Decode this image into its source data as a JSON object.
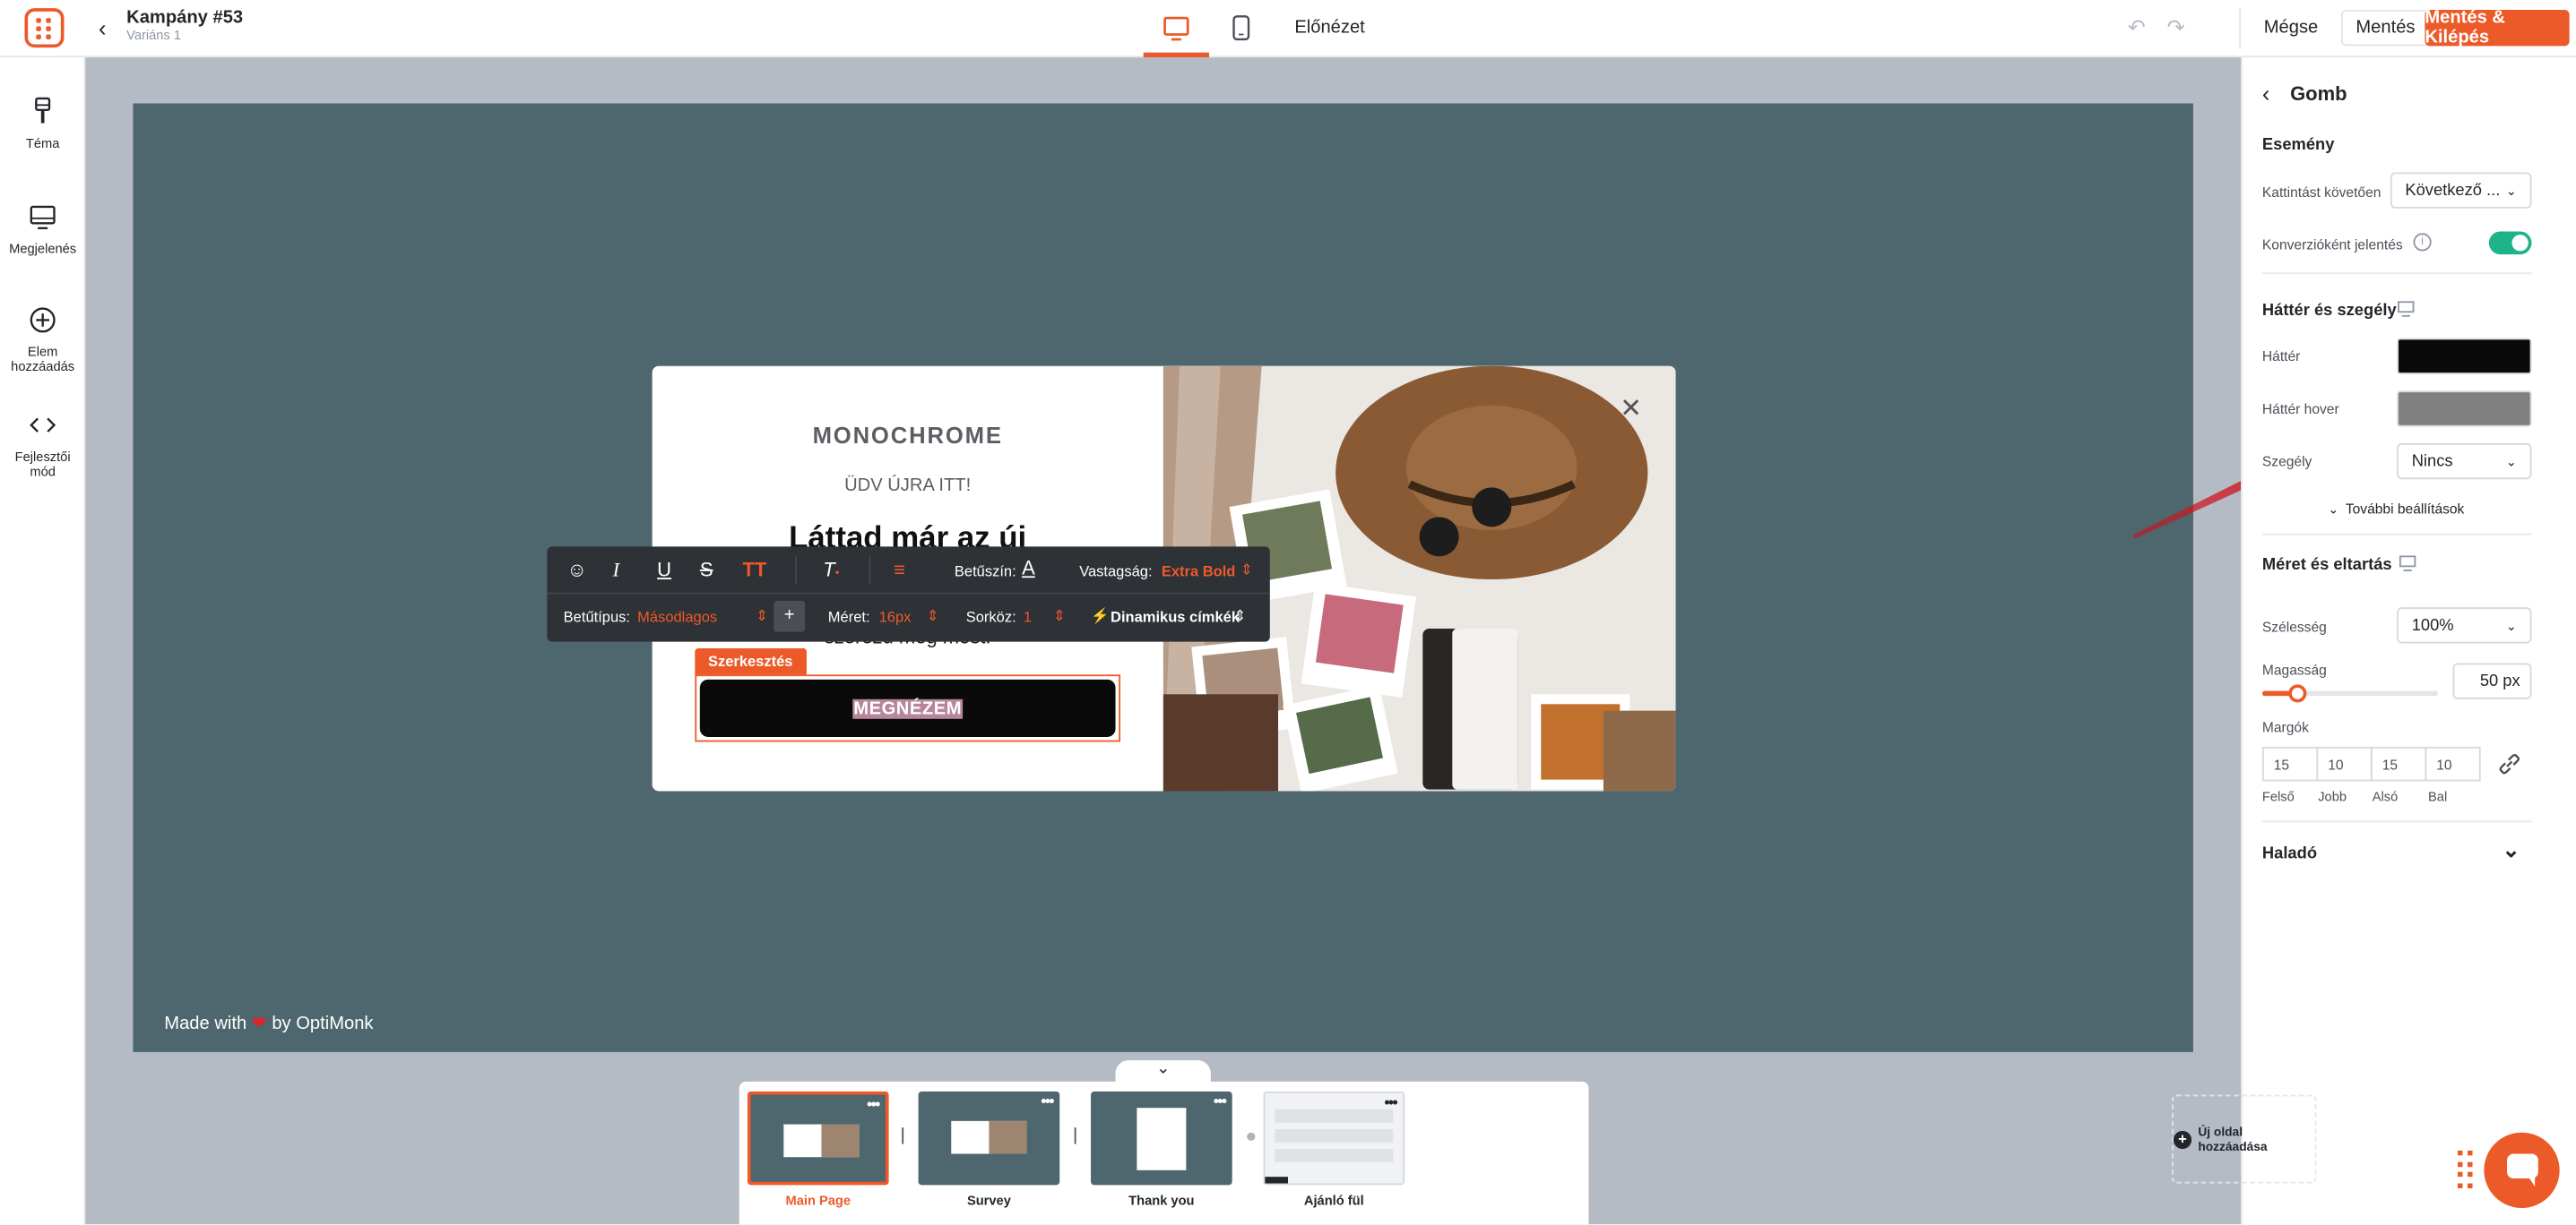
{
  "header": {
    "campaign_title": "Kampány #53",
    "variant": "Variáns 1",
    "preview": "Előnézet",
    "cancel": "Mégse",
    "save": "Mentés",
    "save_exit": "Mentés & Kilépés"
  },
  "sidebar": {
    "items": [
      {
        "label": "Téma",
        "icon": "brush-icon"
      },
      {
        "label": "Megjelenés",
        "icon": "monitor-icon"
      },
      {
        "label": "Elem hozzáadás",
        "icon": "plus-circle-icon"
      },
      {
        "label": "Fejlesztői mód",
        "icon": "code-icon"
      }
    ]
  },
  "canvas": {
    "made_with_prefix": "Made with",
    "made_with_suffix": "by OptiMonk",
    "popup": {
      "brand": "MONOCHROME",
      "welcome": "ÜDV ÚJRA ITT!",
      "headline": "Láttad már az új",
      "subline": "szerezd meg most!",
      "edit_tag": "Szerkesztés",
      "cta": "MEGNÉZEM"
    }
  },
  "toolbar": {
    "font_color_label": "Betűszín:",
    "weight_label": "Vastagság:",
    "weight_value": "Extra Bold",
    "font_label": "Betűtípus:",
    "font_value": "Másodlagos",
    "size_label": "Méret:",
    "size_value": "16px",
    "line_label": "Sorköz:",
    "line_value": "1",
    "dynamic_tags": "Dinamikus címkék"
  },
  "panel": {
    "title": "Gomb",
    "event_heading": "Esemény",
    "after_click_label": "Kattintást követően",
    "after_click_value": "Következő ...",
    "conversion_label": "Konverzióként jelentés",
    "conversion_on": true,
    "bg_heading": "Háttér és szegély",
    "bg_label": "Háttér",
    "bg_color": "#0a0a0a",
    "bg_hover_label": "Háttér hover",
    "bg_hover_color": "#808080",
    "border_label": "Szegély",
    "border_value": "Nincs",
    "more_settings": "További beállítások",
    "size_heading": "Méret és eltartás",
    "width_label": "Szélesség",
    "width_value": "100%",
    "height_label": "Magasság",
    "height_value": "50 px",
    "height_fraction": 0.2,
    "margins_label": "Margók",
    "margins": [
      {
        "value": "15",
        "label": "Felső"
      },
      {
        "value": "10",
        "label": "Jobb"
      },
      {
        "value": "15",
        "label": "Alsó"
      },
      {
        "value": "10",
        "label": "Bal"
      }
    ],
    "advanced": "Haladó"
  },
  "pages": [
    {
      "label": "Main Page",
      "active": true
    },
    {
      "label": "Survey",
      "active": false
    },
    {
      "label": "Thank you",
      "active": false
    },
    {
      "label": "Ajánló fül",
      "active": false
    }
  ],
  "add_page": "Új oldal hozzáadása",
  "colors": {
    "accent": "#ed5a29",
    "toggle": "#1fb38a",
    "workspace": "#4e666d"
  }
}
